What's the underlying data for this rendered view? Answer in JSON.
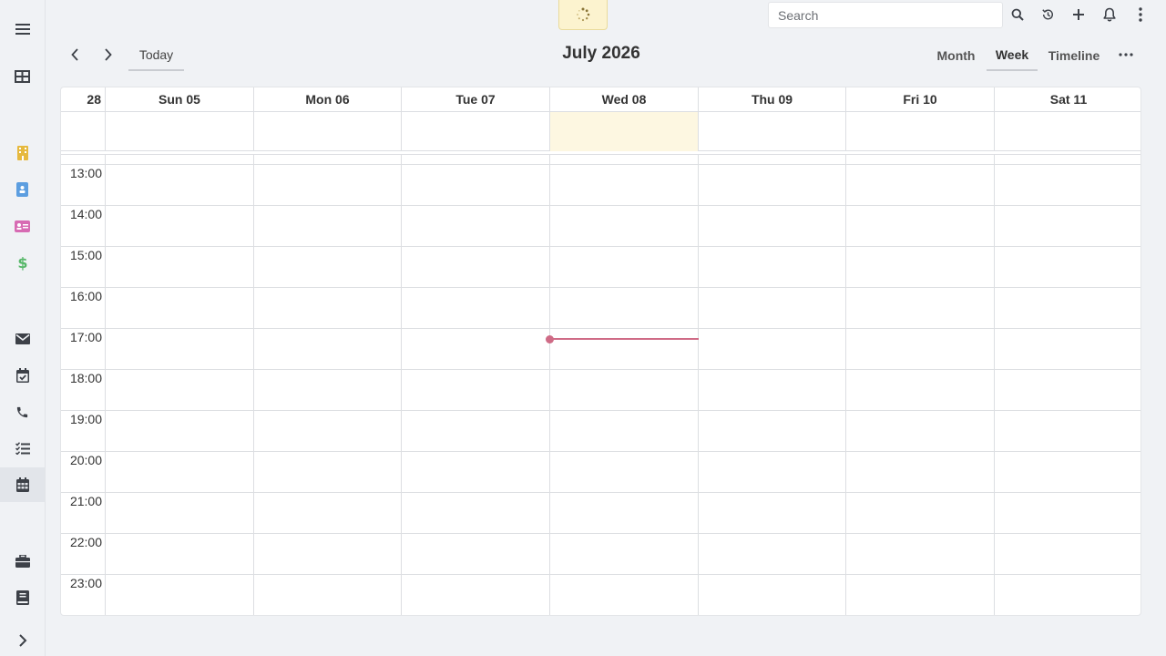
{
  "search": {
    "placeholder": "Search"
  },
  "header": {
    "today_label": "Today",
    "title": "July 2026"
  },
  "views": [
    {
      "label": "Month",
      "active": false
    },
    {
      "label": "Week",
      "active": true
    },
    {
      "label": "Timeline",
      "active": false
    }
  ],
  "week_number": "28",
  "days": [
    "Sun 05",
    "Mon 06",
    "Tue 07",
    "Wed 08",
    "Thu 09",
    "Fri 10",
    "Sat 11"
  ],
  "today_index": 3,
  "hours": [
    "13:00",
    "14:00",
    "15:00",
    "16:00",
    "17:00",
    "18:00",
    "19:00",
    "20:00",
    "21:00",
    "22:00",
    "23:00"
  ],
  "current_time": "17:10",
  "colors": {
    "accent": "#cf6b86",
    "today_bg": "#fdf7e1",
    "sidebar_accounts": "#e6b93e",
    "sidebar_contacts": "#5c9ee0",
    "sidebar_leads": "#d76bb3",
    "sidebar_opportunities": "#58b86a"
  },
  "sidebar": [
    {
      "name": "menu-icon"
    },
    {
      "name": "dashboard-icon"
    },
    {
      "name": "accounts-icon"
    },
    {
      "name": "contacts-icon"
    },
    {
      "name": "leads-icon"
    },
    {
      "name": "opportunities-icon"
    },
    {
      "name": "email-icon"
    },
    {
      "name": "meetings-icon"
    },
    {
      "name": "calls-icon"
    },
    {
      "name": "tasks-icon"
    },
    {
      "name": "calendar-icon"
    },
    {
      "name": "cases-icon"
    },
    {
      "name": "knowledge-base-icon"
    },
    {
      "name": "expand-icon"
    }
  ]
}
